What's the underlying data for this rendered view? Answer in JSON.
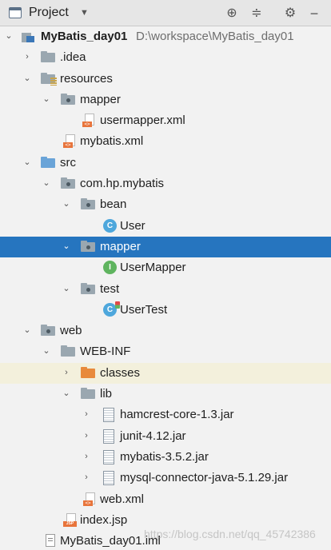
{
  "header": {
    "title": "Project",
    "buttons": [
      "locate-icon",
      "collapse-icon",
      "gear-icon",
      "hide-icon"
    ]
  },
  "tree": {
    "root_label": "MyBatis_day01",
    "root_path": "D:\\workspace\\MyBatis_day01",
    "idea": ".idea",
    "resources": "resources",
    "res_mapper": "mapper",
    "usermapper_xml": "usermapper.xml",
    "mybatis_xml": "mybatis.xml",
    "src": "src",
    "package": "com.hp.mybatis",
    "bean": "bean",
    "user": "User",
    "pkg_mapper": "mapper",
    "usermapper": "UserMapper",
    "test": "test",
    "usertest": "UserTest",
    "web": "web",
    "webinf": "WEB-INF",
    "classes": "classes",
    "lib": "lib",
    "jar1": "hamcrest-core-1.3.jar",
    "jar2": "junit-4.12.jar",
    "jar3": "mybatis-3.5.2.jar",
    "jar4": "mysql-connector-java-5.1.29.jar",
    "web_xml": "web.xml",
    "index_jsp": "index.jsp",
    "iml": "MyBatis_day01.iml"
  },
  "icons": {
    "class_letter": "C",
    "interface_letter": "I",
    "xml_tag": "<>",
    "jsp_tag": "JSP"
  },
  "watermark": "https://blog.csdn.net/qq_45742386",
  "colors": {
    "selection": "#2675bf",
    "highlight_row": "#f3f0dc",
    "folder_blue": "#6aa4d8",
    "folder_orange": "#e88a3c"
  }
}
